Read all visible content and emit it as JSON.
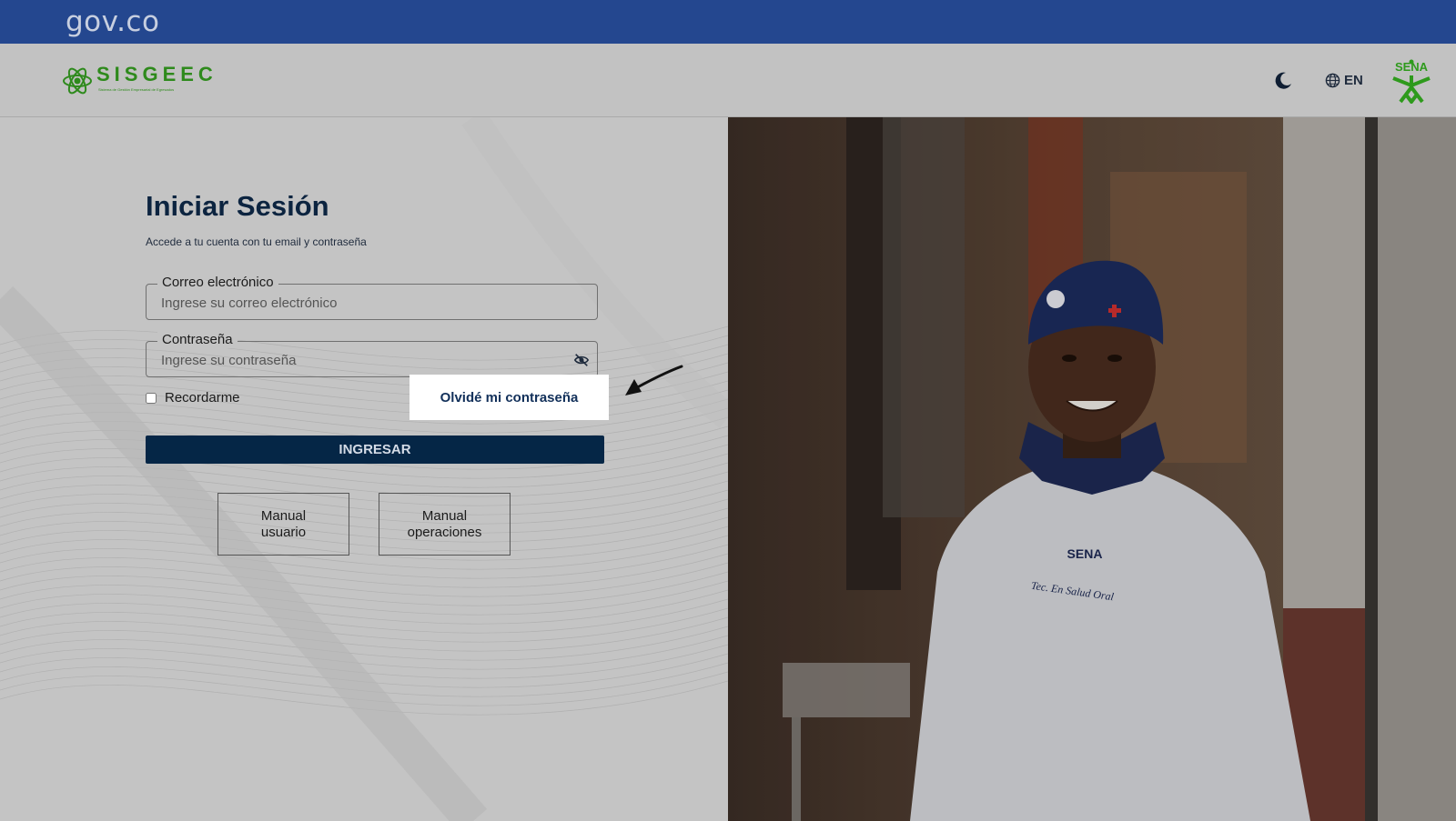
{
  "gov_bar": {
    "logo_text": "gov.co"
  },
  "header": {
    "brand_name": "SISGEEC",
    "brand_subtitle": "Sistema de Gestión Empresarial de Egresados",
    "language_label": "EN",
    "partner_logo_text": "SENA"
  },
  "login": {
    "title": "Iniciar Sesión",
    "subtitle": "Accede a tu cuenta con tu email y contraseña",
    "email": {
      "label": "Correo electrónico",
      "placeholder": "Ingrese su correo electrónico",
      "value": ""
    },
    "password": {
      "label": "Contraseña",
      "placeholder": "Ingrese su contraseña",
      "value": ""
    },
    "remember_label": "Recordarme",
    "remember_checked": false,
    "forgot_label": "Olvidé mi contraseña",
    "submit_label": "INGRESAR",
    "manuals": [
      {
        "label": "Manual\nusuario"
      },
      {
        "label": "Manual\noperaciones"
      }
    ]
  },
  "photo": {
    "embroidery_brand": "SENA",
    "embroidery_text": "Tec. En Salud Oral"
  },
  "colors": {
    "gov_blue": "#24478f",
    "brand_green": "#2e8a1c",
    "primary_navy": "#052646",
    "title_navy": "#0c2440"
  },
  "icons": [
    "moon-icon",
    "globe-icon",
    "eye-off-icon",
    "annotation-arrow-icon"
  ]
}
